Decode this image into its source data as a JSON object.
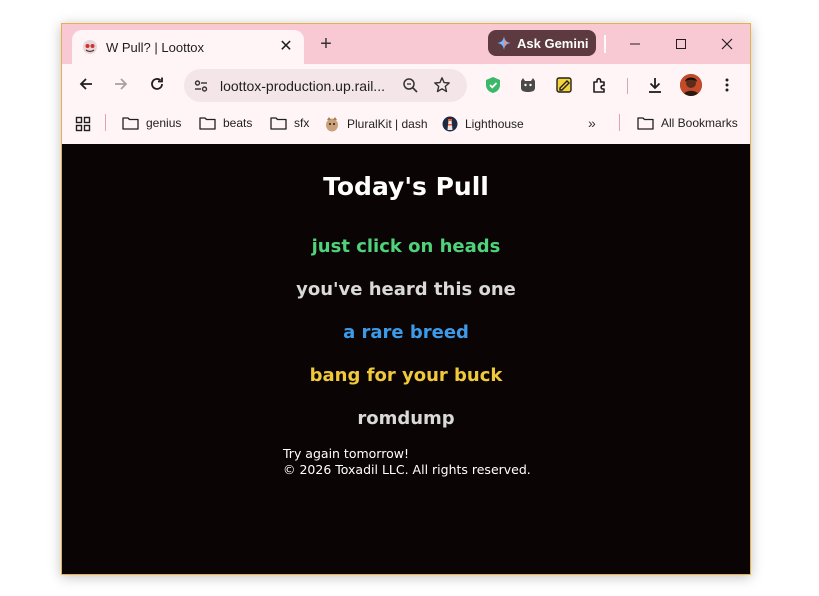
{
  "browser": {
    "tab": {
      "title": "W Pull? | Loottox"
    },
    "gemini_label": "Ask Gemini",
    "url": "loottox-production.up.rail...",
    "bookmarks": [
      {
        "label": "genius"
      },
      {
        "label": "beats"
      },
      {
        "label": "sfx"
      },
      {
        "label": "PluralKit | dash"
      },
      {
        "label": "Lighthouse"
      }
    ],
    "all_bookmarks_label": "All Bookmarks"
  },
  "page": {
    "title": "Today's Pull",
    "pulls": [
      {
        "text": "just click on heads",
        "color": "#4fd37a"
      },
      {
        "text": "you've heard this one",
        "color": "#d9d9d9"
      },
      {
        "text": "a rare breed",
        "color": "#3d9ae8"
      },
      {
        "text": "bang for your buck",
        "color": "#f0c93a"
      },
      {
        "text": "romdump",
        "color": "#d9d9d9"
      }
    ],
    "footer_line1": "Try again tomorrow!",
    "footer_line2": "© 2026 Toxadil LLC. All rights reserved."
  }
}
